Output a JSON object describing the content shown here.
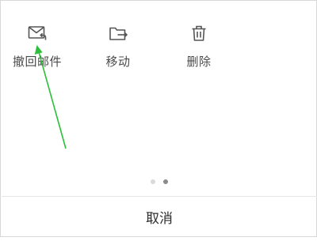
{
  "action_sheet": {
    "actions": [
      {
        "icon": "mail-recall-icon",
        "label": "撤回邮件"
      },
      {
        "icon": "folder-move-icon",
        "label": "移动"
      },
      {
        "icon": "trash-icon",
        "label": "删除"
      }
    ],
    "pager": {
      "total": 2,
      "active_index": 1
    },
    "cancel_label": "取消"
  },
  "annotation": {
    "type": "arrow",
    "color": "#2bbf3a",
    "points_to": "撤回邮件"
  },
  "colors": {
    "icon": "#555555",
    "label": "#4a4a4a",
    "divider": "#e6e6e6",
    "dot_inactive": "#d9d9d9",
    "dot_active": "#8a8a8a"
  }
}
